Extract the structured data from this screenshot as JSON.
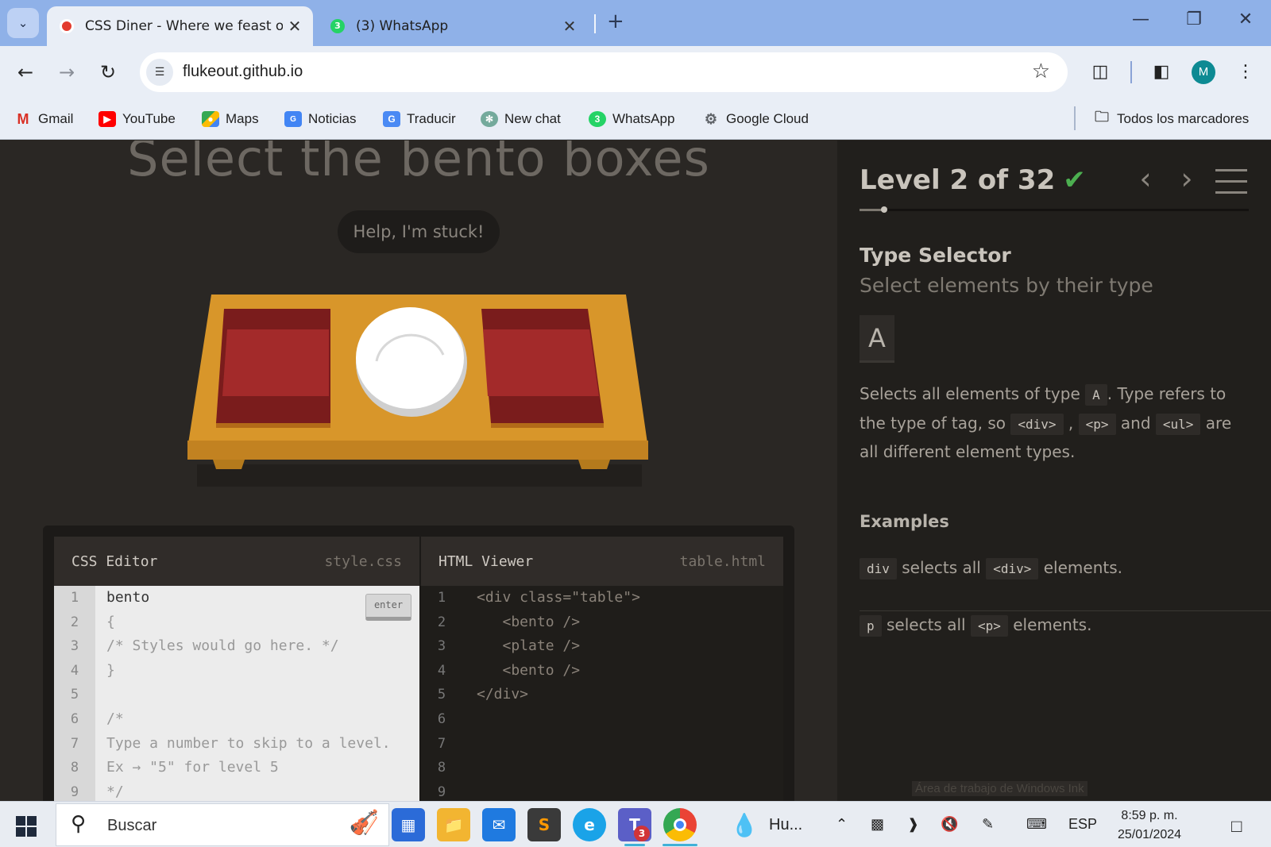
{
  "browser": {
    "tabs": [
      {
        "title": "CSS Diner - Where we feast on CSS",
        "active": true
      },
      {
        "title": "(3) WhatsApp",
        "active": false
      }
    ],
    "tab_badge": "3",
    "url": "flukeout.github.io",
    "profile_initial": "M",
    "bookmarks": [
      {
        "label": "Gmail",
        "icon": "gmail-icon"
      },
      {
        "label": "YouTube",
        "icon": "youtube-icon"
      },
      {
        "label": "Maps",
        "icon": "maps-icon"
      },
      {
        "label": "Noticias",
        "icon": "news-icon"
      },
      {
        "label": "Traducir",
        "icon": "translate-icon"
      },
      {
        "label": "New chat",
        "icon": "chatgpt-icon"
      },
      {
        "label": "WhatsApp",
        "icon": "whatsapp-icon"
      },
      {
        "label": "Google Cloud",
        "icon": "google-cloud-icon"
      }
    ],
    "all_bookmarks": "Todos los marcadores"
  },
  "game": {
    "title": "Select the bento boxes",
    "help_button": "Help, I'm stuck!",
    "css_editor": {
      "title": "CSS Editor",
      "file": "style.css",
      "enter_label": "enter",
      "line_numbers": [
        "1",
        "2",
        "3",
        "4",
        "5",
        "6",
        "7",
        "8",
        "9"
      ],
      "lines": [
        "bento",
        "{",
        "/* Styles would go here. */",
        "}",
        "",
        "/*",
        "Type a number to skip to a level.",
        "Ex → \"5\" for level 5",
        "*/"
      ]
    },
    "html_viewer": {
      "title": "HTML Viewer",
      "file": "table.html",
      "line_numbers": [
        "1",
        "2",
        "3",
        "4",
        "5",
        "6",
        "7",
        "8",
        "9"
      ],
      "lines": [
        "<div class=\"table\">",
        "   <bento />",
        "   <plate />",
        "   <bento />",
        "</div>",
        "",
        "",
        "",
        ""
      ]
    }
  },
  "sidebar": {
    "level_label": "Level 2 of 32",
    "level_current": 2,
    "level_total": 32,
    "completed": true,
    "selector_name": "Type Selector",
    "selector_title": "Select elements by their type",
    "syntax": "A",
    "hint_parts": [
      "Selects all elements of type",
      "A",
      ". Type refers to the type of tag, so",
      "<div>",
      ",",
      "<p>",
      "and",
      "<ul>",
      "are all different element types."
    ],
    "examples_title": "Examples",
    "examples": [
      {
        "code": "div",
        "text": "selects all",
        "tag": "<div>",
        "suffix": "elements."
      },
      {
        "code": "p",
        "text": "selects all",
        "tag": "<p>",
        "suffix": "elements."
      }
    ],
    "ink_workspace": "Área de trabajo de Windows Ink"
  },
  "taskbar": {
    "search_placeholder": "Buscar",
    "teams_badge": "3",
    "weather_app": "Hu...",
    "language": "ESP",
    "time": "8:59 p. m.",
    "date": "25/01/2024"
  },
  "colors": {
    "tab_strip": "#8fb1e8",
    "toolbar": "#e9eef6",
    "page_bg": "#2a2724",
    "table_wood": "#d8962a",
    "bento_red": "#a32a2a",
    "check_green": "#4caf50"
  }
}
